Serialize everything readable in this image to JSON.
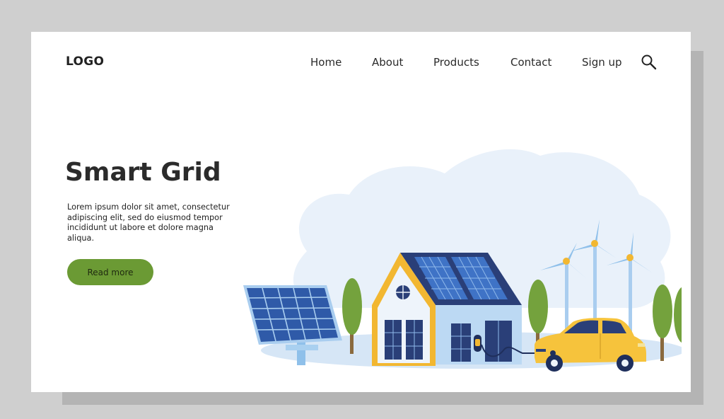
{
  "header": {
    "logo": "LOGO",
    "nav": {
      "home": "Home",
      "about": "About",
      "products": "Products",
      "contact": "Contact",
      "signup": "Sign up"
    },
    "search_icon": "search-icon"
  },
  "hero": {
    "title": "Smart Grid",
    "body": "Lorem ipsum dolor sit amet, consectetur adipiscing elit, sed do eiusmod tempor incididunt ut labore et dolore magna aliqua.",
    "cta_label": "Read more"
  },
  "colors": {
    "page_background": "#ffffff",
    "outer_background": "#cfcfcf",
    "cta_green": "#6b9a34",
    "panel_blue": "#2f5aa8",
    "roof_navy": "#2a3f78",
    "house_yellow": "#f2b731",
    "car_yellow": "#f6c33c",
    "tree_green": "#74a23d",
    "cloud_blue": "#e8f0f9"
  }
}
